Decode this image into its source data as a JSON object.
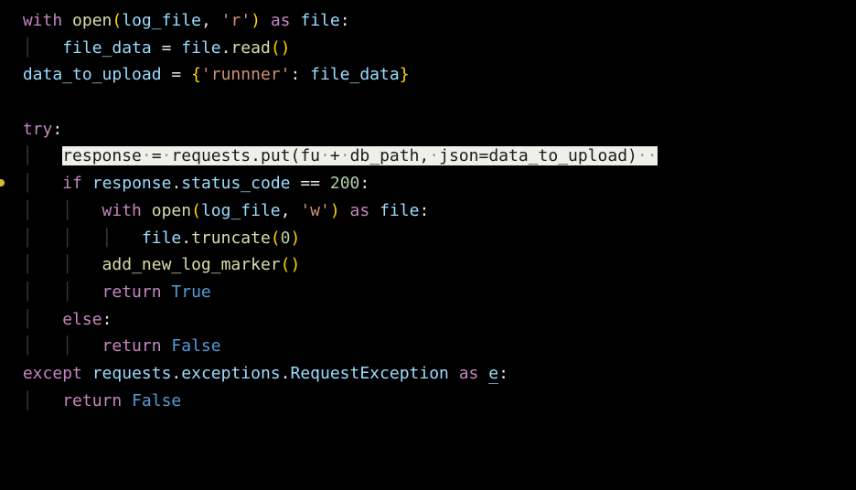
{
  "domain": "Computer-Use",
  "colors": {
    "background": "#000000",
    "highlight_bg": "#f0f0ea",
    "keyword": "#c586c0",
    "function": "#dcdcaa",
    "variable": "#9cdcfe",
    "string": "#ce9178",
    "number": "#b5cea8",
    "constant": "#569cd6"
  },
  "tokens": {
    "with": "with",
    "open": "open",
    "log_file": "log_file",
    "r": "'r'",
    "as": "as",
    "file": "file",
    "file_data": "file_data",
    "eq": " = ",
    "read": "read",
    "data_to_upload": "data_to_upload",
    "runnner": "'runnner'",
    "colon": ": ",
    "try": "try",
    "response": "response",
    "requests": "requests",
    "put": "put",
    "fu": "fu",
    "plus": " + ",
    "db_path": "db_path",
    "comma_sp": ", ",
    "json_kw": "json",
    "if": "if",
    "status_code": "status_code",
    "eqeq": " == ",
    "n200": "200",
    "w": "'w'",
    "truncate": "truncate",
    "n0": "0",
    "add_new_log_marker": "add_new_log_marker",
    "return": "return",
    "True": "True",
    "else": "else",
    "False": "False",
    "except": "except",
    "exceptions": "exceptions",
    "RequestException": "RequestException",
    "e": "e",
    "dot": ".",
    "lp": "(",
    "rp": ")",
    "lb": "{",
    "rb": "}",
    "col": ":",
    "ws_dot": "·",
    "hl_full": "response·=·requests.put(fu·+·db_path,·json=data_to_upload)··"
  },
  "code_text": "with open(log_file, 'r') as file:\n    file_data = file.read()\ndata_to_upload = {'runnner': file_data}\n\ntry:\n    response = requests.put(fu + db_path, json=data_to_upload)  \n    if response.status_code == 200:\n        with open(log_file, 'w') as file:\n            file.truncate(0)\n        add_new_log_marker()\n        return True\n    else:\n        return False\nexcept requests.exceptions.RequestException as e:\n    return False"
}
